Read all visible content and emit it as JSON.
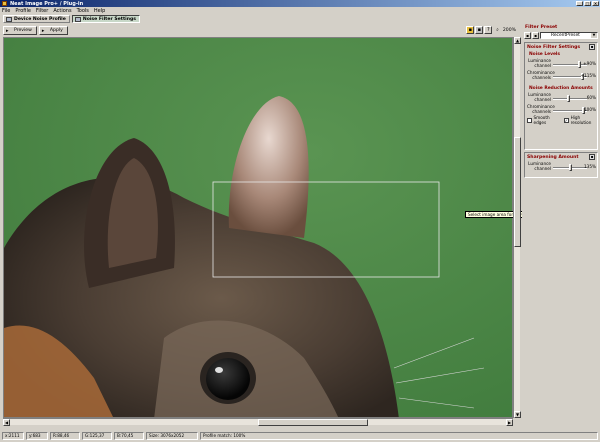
{
  "window": {
    "title": "Neat Image Pro+ / Plug-in",
    "controls": [
      "_",
      "□",
      "×"
    ]
  },
  "menu": [
    "File",
    "Profile",
    "Filter",
    "Actions",
    "Tools",
    "Help"
  ],
  "tabs": [
    {
      "label": "Device Noise Profile"
    },
    {
      "label": "Noise Filter Settings"
    }
  ],
  "toolbar": {
    "preview_label": "Preview",
    "apply_label": "Apply",
    "zoom": "200%"
  },
  "tooltip": "Select image area for preview",
  "panel": {
    "filter_preset_title": "Filter Preset",
    "preset_value": "RecentPreset",
    "noise_filter_settings_title": "Noise Filter Settings",
    "noise_levels_title": "Noise Levels",
    "noise_levels": [
      {
        "label": "Luminance channel",
        "value": "+90%",
        "level": 0.82
      },
      {
        "label": "Chrominance channels",
        "value": "+115%",
        "level": 0.9
      }
    ],
    "reduction_title": "Noise Reduction Amounts",
    "reduction": [
      {
        "label": "Luminance channel",
        "value": "60%",
        "level": 0.45
      },
      {
        "label": "Chrominance channels",
        "value": "100%",
        "level": 0.95
      }
    ],
    "smooth_edges_label": "Smooth edges",
    "smooth_edges_checked": false,
    "high_res_label": "High resolution",
    "high_res_checked": true,
    "sharpening_title": "Sharpening Amount",
    "sharpening": [
      {
        "label": "Luminance channel",
        "value": "135%",
        "level": 0.5
      }
    ]
  },
  "status": [
    "x:2111",
    "y:683",
    "R:88,46",
    "G:125,37",
    "B:70,45",
    "Size: 3076x2052",
    "Profile match: 100%"
  ],
  "colors": {
    "title_start": "#0a246a",
    "title_end": "#a6caf0",
    "panel_heading": "#8b0000",
    "background_green": "#4f8a4a"
  },
  "icons": [
    "app-icon",
    "profile-tab-icon",
    "filter-tab-icon",
    "preview-icon",
    "apply-icon",
    "zoom-icon",
    "save-icon",
    "open-icon",
    "help-icon"
  ]
}
